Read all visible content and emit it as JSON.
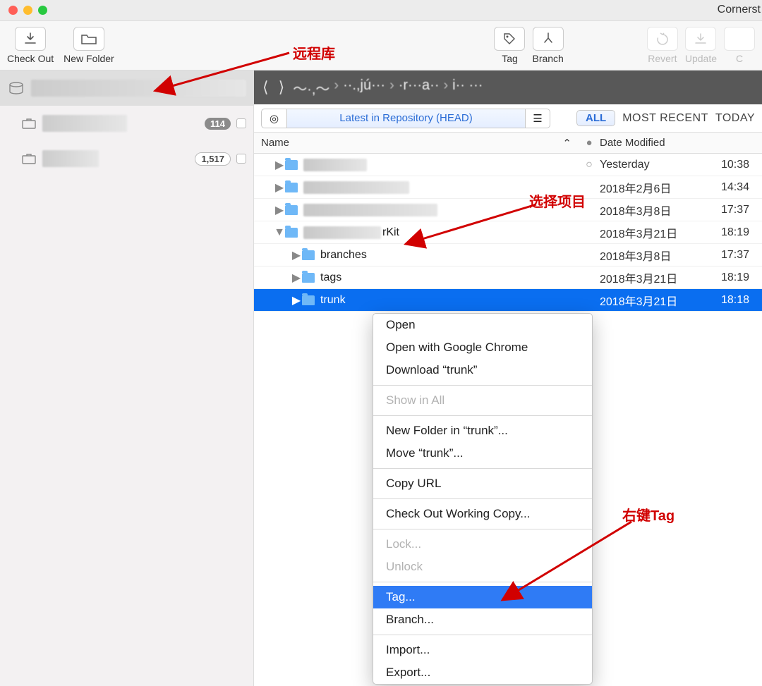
{
  "app_title": "Cornerst",
  "toolbar": {
    "checkout": "Check Out",
    "newfolder": "New Folder",
    "tag": "Tag",
    "branch": "Branch",
    "revert": "Revert",
    "update": "Update",
    "c_partial": "C"
  },
  "sidebar": {
    "wc1_count": "114",
    "wc2_count": "1,517"
  },
  "pathbar": {
    "seg1": "～·,～",
    "seg2": "··.,jú···",
    "seg3": "·r···a··",
    "seg4": "i·· ···"
  },
  "filter": {
    "rev_label": "Latest in Repository (HEAD)",
    "all": "ALL",
    "most_recent": "MOST RECENT",
    "today": "TODAY"
  },
  "columns": {
    "name": "Name",
    "date": "Date Modified"
  },
  "rows": [
    {
      "indent": 28,
      "tri": "▶",
      "name_blur": 90,
      "date": "Yesterday",
      "time": "10:38",
      "dot": "○"
    },
    {
      "indent": 28,
      "tri": "▶",
      "name_blur": 150,
      "date": "2018年2月6日",
      "time": "14:34"
    },
    {
      "indent": 28,
      "tri": "▶",
      "name_blur": 190,
      "date": "2018年3月8日",
      "time": "17:37"
    },
    {
      "indent": 28,
      "tri": "▼",
      "name_blur": 110,
      "suffix": "rKit",
      "date": "2018年3月21日",
      "time": "18:19"
    },
    {
      "indent": 52,
      "tri": "▶",
      "name": "branches",
      "date": "2018年3月8日",
      "time": "17:37"
    },
    {
      "indent": 52,
      "tri": "▶",
      "name": "tags",
      "date": "2018年3月21日",
      "time": "18:19"
    },
    {
      "indent": 52,
      "tri": "▶",
      "name": "trunk",
      "date": "2018年3月21日",
      "time": "18:18",
      "sel": true
    }
  ],
  "ctx": {
    "open": "Open",
    "open_chrome": "Open with Google Chrome",
    "download": "Download “trunk”",
    "show_all": "Show in All",
    "newfolder_in": "New Folder in “trunk”...",
    "move": "Move “trunk”...",
    "copy_url": "Copy URL",
    "checkout_wc": "Check Out Working Copy...",
    "lock": "Lock...",
    "unlock": "Unlock",
    "tag": "Tag...",
    "branch": "Branch...",
    "import": "Import...",
    "export": "Export..."
  },
  "anno": {
    "remote": "远程库",
    "select_project": "选择项目",
    "right_tag": "右键Tag"
  }
}
